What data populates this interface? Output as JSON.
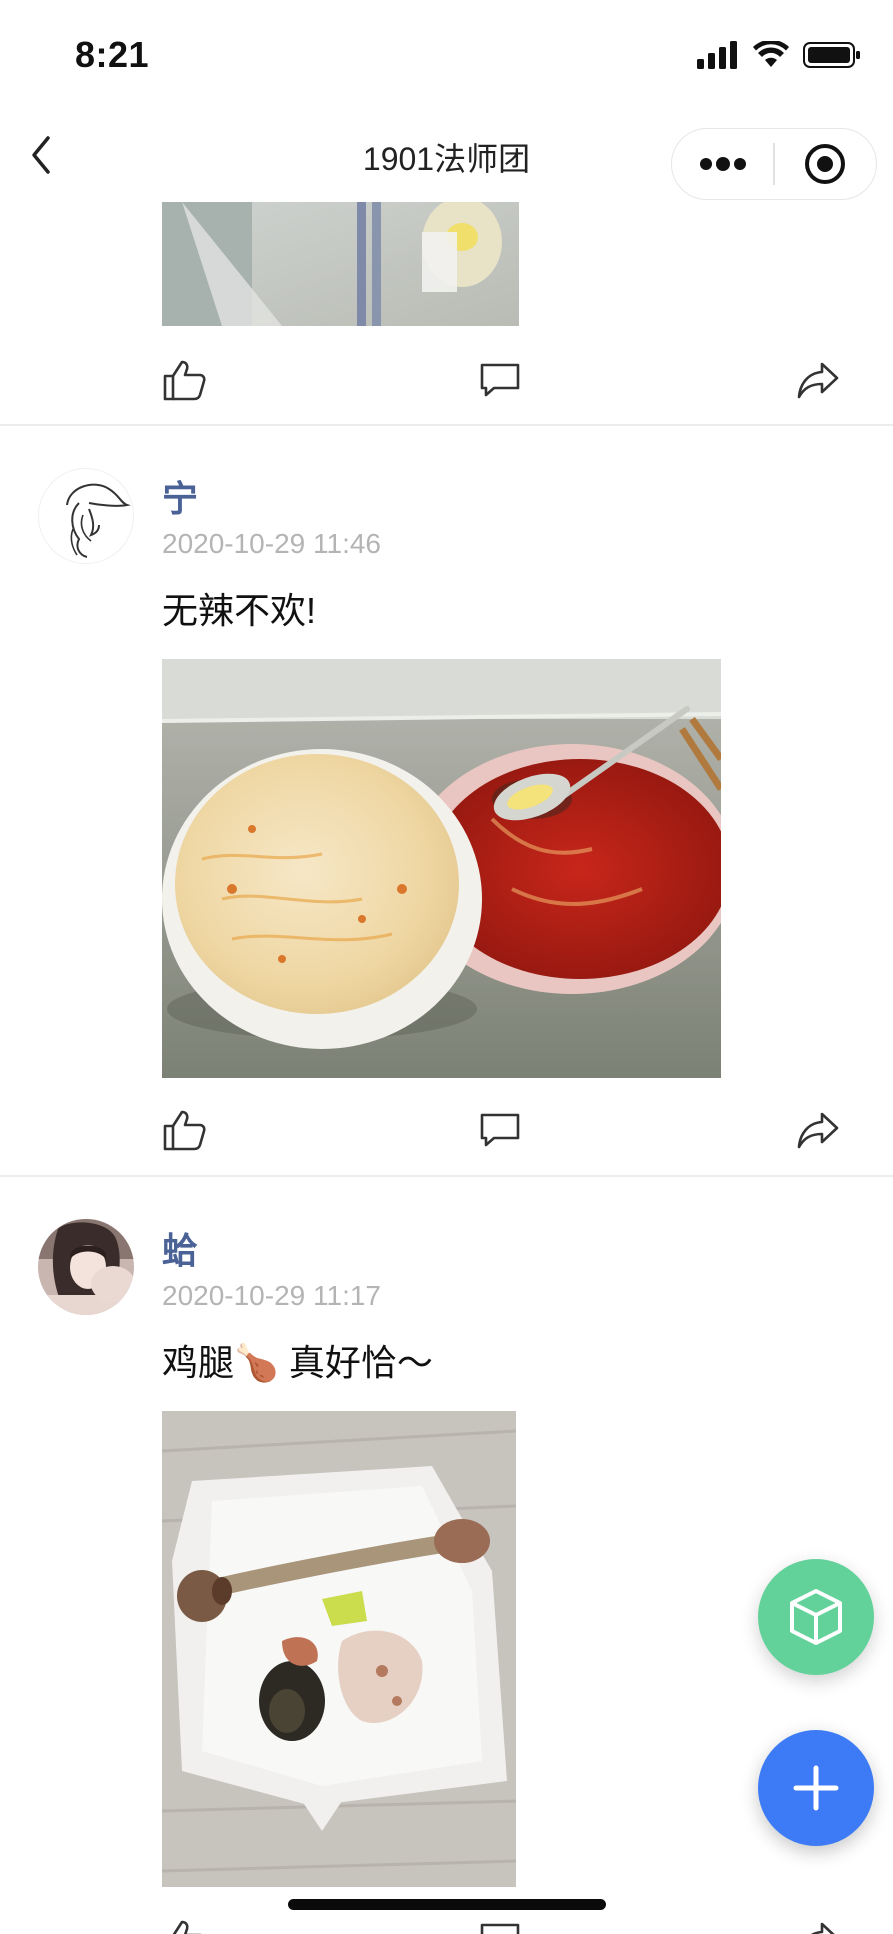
{
  "status_bar": {
    "time": "8:21"
  },
  "nav": {
    "title": "1901法师团"
  },
  "icons": {
    "back": "chevron-left-icon",
    "more": "more-dots-icon",
    "target": "target-icon",
    "like": "thumbs-up-icon",
    "comment": "comment-icon",
    "share": "share-icon",
    "box": "cube-icon",
    "add": "plus-icon"
  },
  "colors": {
    "author_name": "#4a6296",
    "timestamp": "#b4b4b4",
    "fab_green": "#62d29a",
    "fab_blue": "#3c7bf5"
  },
  "posts": [
    {
      "author": "宁",
      "time": "2020-10-29 11:46",
      "text": "无辣不欢!"
    },
    {
      "author": "蛤",
      "time": "2020-10-29 11:17",
      "text_before": "鸡腿",
      "emoji": "🍗",
      "text_after": " 真好恰～"
    }
  ]
}
